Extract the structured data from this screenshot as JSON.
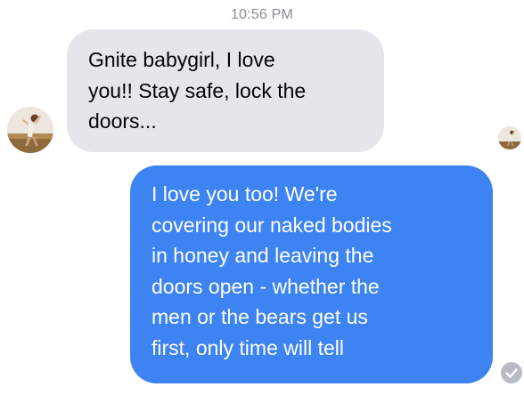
{
  "conversation": {
    "timestamp": "10:56 PM",
    "messages": [
      {
        "sender": "other",
        "text": "Gnite babygirl, I love\nyou!! Stay safe, lock the\ndoors..."
      },
      {
        "sender": "me",
        "text": "I love you too! We're\ncovering our naked bodies\nin honey and leaving the\ndoors open - whether the\nmen or the bears get us\nfirst, only time will tell"
      }
    ]
  },
  "icons": {
    "contact_avatar": "avatar-photo-icon",
    "seen_avatar": "seen-avatar-icon",
    "delivered_status": "check-circle-icon"
  },
  "colors": {
    "received_bubble": "#e4e6eb",
    "sent_bubble": "#3d83f2",
    "timestamp_text": "#8a8d91",
    "status_check": "#b8bcc2"
  }
}
